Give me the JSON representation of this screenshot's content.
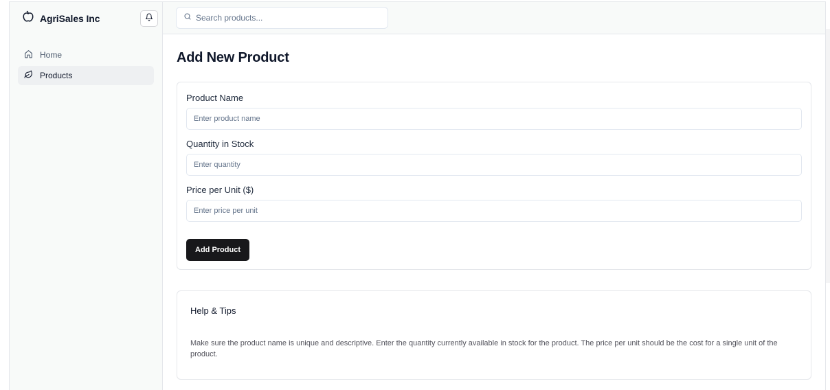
{
  "app": {
    "name": "AgriSales Inc",
    "logo_icon": "apple-icon",
    "notification_icon": "bell-icon"
  },
  "sidebar": {
    "items": [
      {
        "label": "Home",
        "icon": "home-icon",
        "active": false
      },
      {
        "label": "Products",
        "icon": "leaf-icon",
        "active": true
      }
    ]
  },
  "search": {
    "placeholder": "Search products...",
    "icon": "search-icon"
  },
  "page": {
    "title": "Add New Product"
  },
  "form": {
    "fields": [
      {
        "label": "Product Name",
        "placeholder": "Enter product name",
        "value": ""
      },
      {
        "label": "Quantity in Stock",
        "placeholder": "Enter quantity",
        "value": ""
      },
      {
        "label": "Price per Unit ($)",
        "placeholder": "Enter price per unit",
        "value": ""
      }
    ],
    "submit_label": "Add Product"
  },
  "help": {
    "title": "Help & Tips",
    "text": "Make sure the product name is unique and descriptive. Enter the quantity currently available in stock for the product. The price per unit should be the cost for a single unit of the product."
  },
  "colors": {
    "primary_button": "#18181b",
    "sidebar_bg": "#f8faf9",
    "active_nav_bg": "#eef0f2",
    "border": "#e5e7eb"
  }
}
